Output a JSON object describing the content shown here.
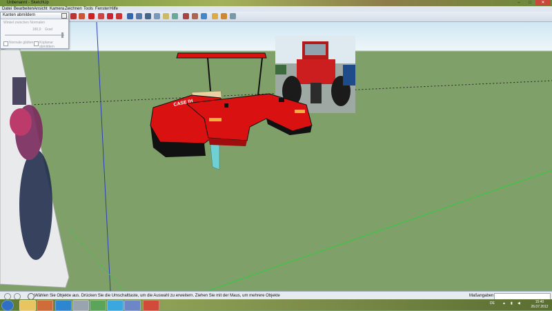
{
  "window": {
    "title": "Unbenannt - SketchUp",
    "min_label": "–",
    "max_label": "□",
    "close_label": "✕"
  },
  "menu": {
    "items": [
      "Datei",
      "Bearbeiten",
      "Ansicht",
      "Kamera",
      "Zeichnen",
      "Tools",
      "Fenster",
      "Hilfe"
    ]
  },
  "toolbar": {
    "icons": [
      "select-icon",
      "eraser-icon",
      "paint-icon",
      "line-icon",
      "arc-icon",
      "rectangle-icon",
      "circle-icon",
      "polygon-icon",
      "push-pull-icon",
      "follow-me-icon",
      "move-icon",
      "rotate-icon",
      "scale-icon",
      "offset-icon",
      "tape-icon",
      "dimension-icon",
      "protractor-icon",
      "text-icon",
      "axes-icon",
      "section-icon",
      "orbit-icon",
      "pan-icon",
      "zoom-icon",
      "zoom-window-icon",
      "zoom-extents-icon",
      "previous-view-icon",
      "position-camera-icon",
      "walk-icon",
      "look-around-icon",
      "get-models-icon",
      "share-model-icon",
      "components-icon",
      "warehouse-icon"
    ]
  },
  "soften_tray": {
    "title": "Kanten abmildern",
    "angle_label": "Winkel zwischen Normalen",
    "angle_value": "180,0",
    "angle_unit": "Grad",
    "normals_label": "Normale glätten",
    "coplanar_label": "Koplanar abmildern"
  },
  "model": {
    "brand": "CASE IH",
    "photo_label": "tractor-rear-photo"
  },
  "status": {
    "hint": "Wählen Sie Objekte aus. Drücken Sie die Umschalttaste, um die Auswahl zu erweitern. Ziehen Sie mit der Maus, um mehrere Objekte",
    "measurements_label": "Maßangaben",
    "measurements_value": ""
  },
  "taskbar": {
    "language": "DE",
    "time": "15:40",
    "date": "26.07.2012"
  },
  "colors": {
    "ground": "#7fa069",
    "sky": "#dfeff5",
    "tractor_red": "#d91111",
    "hood_dark": "#a00d0d",
    "glass": "#6fd0d3",
    "axis_red": "#c33",
    "axis_green": "#2ecc40",
    "axis_blue": "#2b3fb3"
  }
}
